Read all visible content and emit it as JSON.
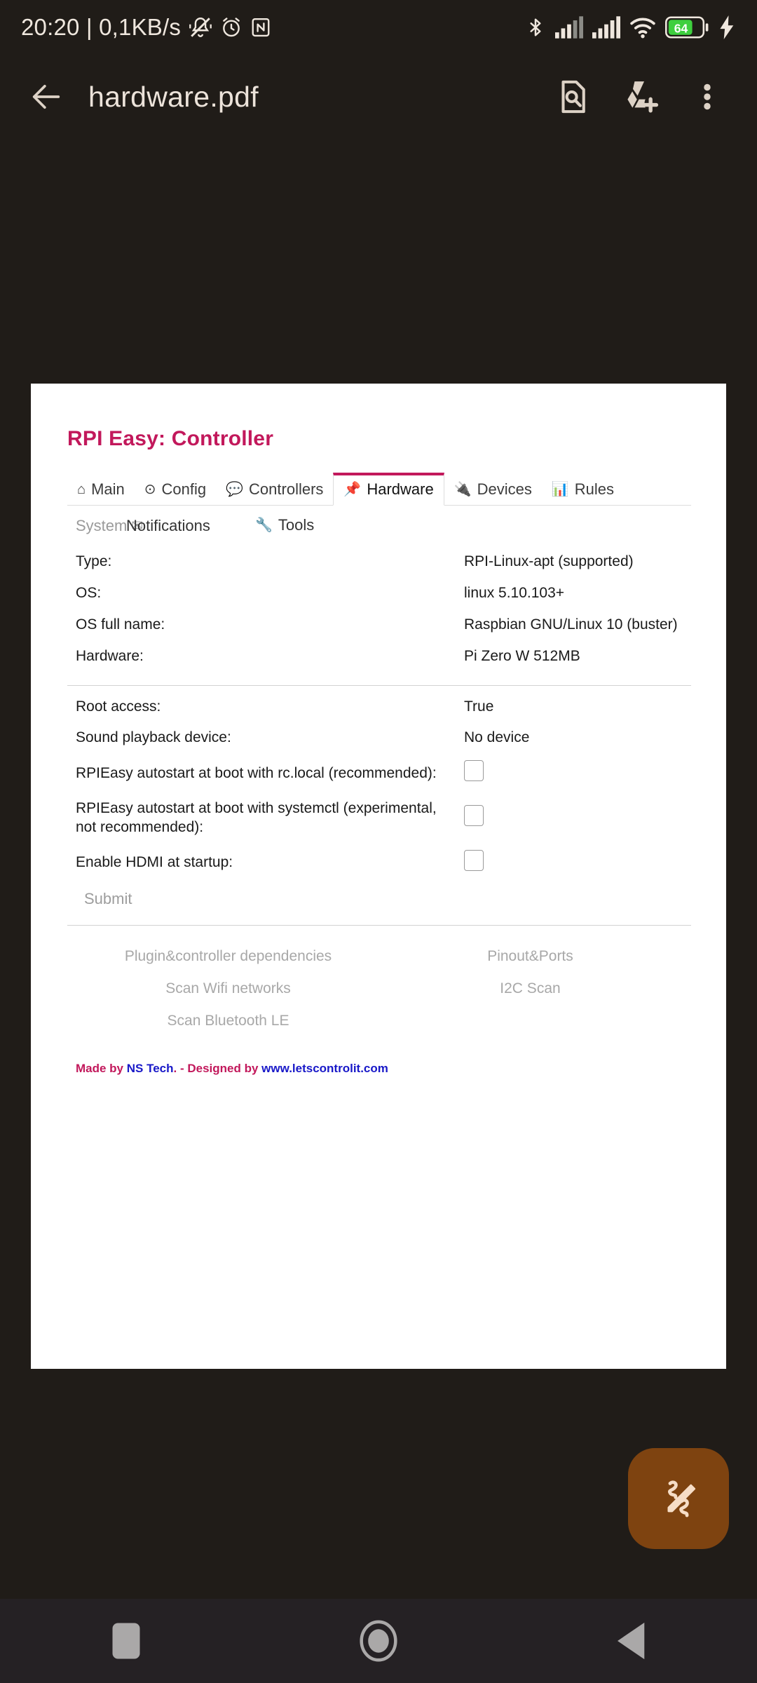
{
  "status_bar": {
    "time_and_rate": "20:20 | 0,1KB/s",
    "icons": [
      "bell-mute-icon",
      "alarm-clock-icon",
      "nfc-icon",
      "bluetooth-icon",
      "signal-1-icon",
      "signal-2-icon",
      "wifi-icon",
      "battery-icon",
      "charging-bolt-icon"
    ],
    "battery_level": "64"
  },
  "toolbar": {
    "back_label": "back-arrow-icon",
    "title": "hardware.pdf",
    "search_in_doc_label": "document-search-icon",
    "add_to_drive_label": "add-to-drive-icon",
    "overflow_label": "more-options-icon"
  },
  "document": {
    "app_title": "RPI Easy: Controller",
    "tabs": [
      {
        "label": "Main",
        "icon": "⌂",
        "active": false
      },
      {
        "label": "Config",
        "icon": "⊙",
        "active": false
      },
      {
        "label": "Controllers",
        "icon": "💬",
        "active": false
      },
      {
        "label": "Hardware",
        "icon": "📌",
        "active": true
      },
      {
        "label": "Devices",
        "icon": "🔌",
        "active": false
      },
      {
        "label": "Rules",
        "icon": "📊",
        "active": false
      }
    ],
    "subtabs": {
      "system": "System",
      "notifications": "Notifications",
      "tools": "Tools",
      "tools_icon": "🔧",
      "system_icon": "✉"
    },
    "system_info": [
      {
        "label": "Type:",
        "value": "RPI-Linux-apt (supported)"
      },
      {
        "label": "OS:",
        "value": "linux 5.10.103+"
      },
      {
        "label": "OS full name:",
        "value": "Raspbian GNU/Linux 10 (buster)"
      },
      {
        "label": "Hardware:",
        "value": "Pi Zero W 512MB"
      }
    ],
    "settings": [
      {
        "label": "Root access:",
        "value": "True",
        "type": "text"
      },
      {
        "label": "Sound playback device:",
        "value": "No device",
        "type": "text"
      },
      {
        "label": "RPIEasy autostart at boot with rc.local (recommended):",
        "value": "",
        "type": "checkbox",
        "checked": false
      },
      {
        "label": "RPIEasy autostart at boot with systemctl (experimental, not recommended):",
        "value": "",
        "type": "checkbox",
        "checked": false
      },
      {
        "label": "Enable HDMI at startup:",
        "value": "",
        "type": "checkbox",
        "checked": false
      }
    ],
    "submit_label": "Submit",
    "action_links": [
      "Plugin&controller dependencies",
      "Pinout&Ports",
      "Scan Wifi networks",
      "I2C Scan",
      "Scan Bluetooth LE",
      ""
    ],
    "footer": {
      "made_by_prefix": "Made by ",
      "made_by_name": "NS Tech",
      "designed_by": ". - Designed by ",
      "site": "www.letscontrolit.com"
    }
  },
  "fab": {
    "label": "annotate-icon"
  },
  "nav_bar": {
    "recents_label": "recents-button",
    "home_label": "home-button",
    "back_label": "back-button"
  },
  "colors": {
    "accent": "#c2185b",
    "link": "#1818c8",
    "fab": "#7e4310",
    "screen_bg": "#201c18",
    "battery": "#3ecf3e"
  }
}
